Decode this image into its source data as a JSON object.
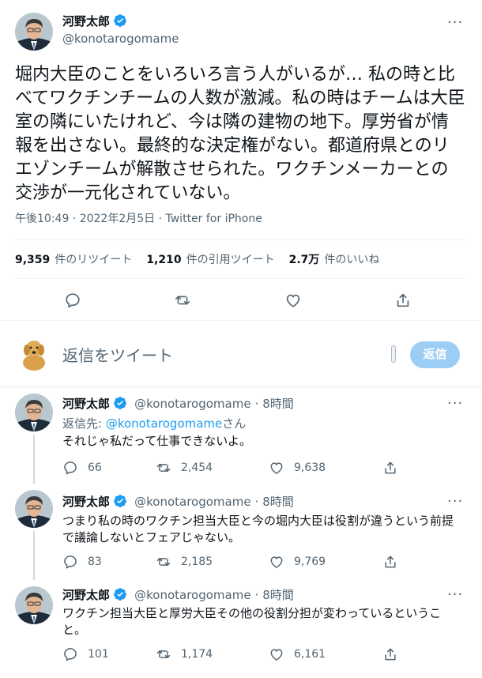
{
  "main_tweet": {
    "author_name": "河野太郎",
    "handle": "@konotarogomame",
    "text": "堀内大臣のことをいろいろ言う人がいるが… 私の時と比べてワクチンチームの人数が激減。私の時はチームは大臣室の隣にいたけれど、今は隣の建物の地下。厚労省が情報を出さない。最終的な決定権がない。都道府県とのリエゾンチームが解散させられた。ワクチンメーカーとの交渉が一元化されていない。",
    "time": "午後10:49 · 2022年2月5日 · ",
    "source": "Twitter for iPhone",
    "stats": [
      {
        "num": "9,359",
        "label": "件のリツイート"
      },
      {
        "num": "1,210",
        "label": "件の引用ツイート"
      },
      {
        "num": "2.7万",
        "label": "件のいいね"
      }
    ]
  },
  "compose": {
    "placeholder": "返信をツイート",
    "button": "返信"
  },
  "replies": [
    {
      "author_name": "河野太郎",
      "handle": "@konotarogomame",
      "time": "· 8時間",
      "reply_to_prefix": "返信先: ",
      "reply_to_handle": "@konotarogomame",
      "reply_to_suffix": "さん",
      "text": "それじゃ私だって仕事できないよ。",
      "replies": "66",
      "retweets": "2,454",
      "likes": "9,638"
    },
    {
      "author_name": "河野太郎",
      "handle": "@konotarogomame",
      "time": "· 8時間",
      "text": "つまり私の時のワクチン担当大臣と今の堀内大臣は役割が違うという前提で議論しないとフェアじゃない。",
      "replies": "83",
      "retweets": "2,185",
      "likes": "9,769"
    },
    {
      "author_name": "河野太郎",
      "handle": "@konotarogomame",
      "time": "· 8時間",
      "text": "ワクチン担当大臣と厚労大臣その他の役割分担が変わっているということ。",
      "replies": "101",
      "retweets": "1,174",
      "likes": "6,161"
    }
  ],
  "colors": {
    "accent": "#1d9bf0",
    "secondary_text": "#536471",
    "divider": "#eff3f4"
  },
  "icons": [
    "verified-badge-icon",
    "more-icon",
    "reply-icon",
    "retweet-icon",
    "like-icon",
    "share-icon"
  ]
}
